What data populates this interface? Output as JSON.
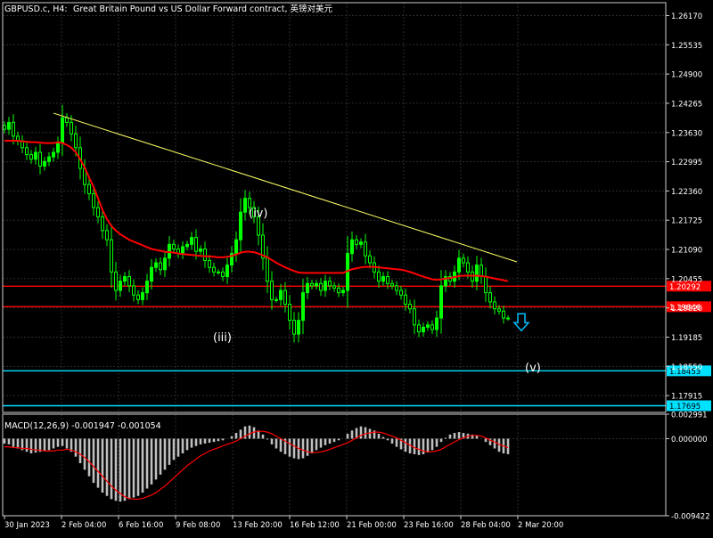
{
  "header": {
    "symbol": "GBPUSD.c, H4:",
    "description": "Great Britain Pound vs US Dollar Forward contract, 英镑对美元"
  },
  "colors": {
    "background": "#000000",
    "grid": "#2d2d2d",
    "frame": "#cfcfcf",
    "candle": "#00ff00",
    "ma": "#ff0000",
    "trendline": "#ffff66",
    "resistance": "#ff0000",
    "support": "#00e0ff",
    "arrow": "#00bfff",
    "text": "#ffffff",
    "macd_hist": "#c0c0c0",
    "macd_signal": "#ff0000"
  },
  "chart_data": [
    {
      "type": "candlestick",
      "ylim": [
        1.1755,
        1.2645
      ],
      "yticks": [
        "1.26170",
        "1.25535",
        "1.24900",
        "1.24265",
        "1.23630",
        "1.22995",
        "1.22360",
        "1.21725",
        "1.21090",
        "1.20455",
        "1.19820",
        "1.19185",
        "1.18550",
        "1.17915"
      ],
      "xticks": [
        "30 Jan 2023",
        "2 Feb 04:00",
        "6 Feb 16:00",
        "9 Feb 08:00",
        "13 Feb 20:00",
        "16 Feb 12:00",
        "21 Feb 00:00",
        "23 Feb 16:00",
        "28 Feb 04:00",
        "2 Mar 20:00"
      ],
      "close": [
        1.237,
        1.2385,
        1.2355,
        1.2345,
        1.233,
        1.2315,
        1.2305,
        1.232,
        1.229,
        1.23,
        1.231,
        1.232,
        1.234,
        1.2395,
        1.2385,
        1.236,
        1.233,
        1.2285,
        1.225,
        1.223,
        1.22,
        1.218,
        1.215,
        1.213,
        1.206,
        1.202,
        1.204,
        1.205,
        1.203,
        1.201,
        1.2,
        1.2015,
        1.204,
        1.207,
        1.208,
        1.2065,
        1.209,
        1.212,
        1.211,
        1.21,
        1.2115,
        1.212,
        1.2135,
        1.2105,
        1.211,
        1.2085,
        1.207,
        1.206,
        1.206,
        1.205,
        1.2075,
        1.21,
        1.213,
        1.219,
        1.222,
        1.22,
        1.218,
        1.214,
        1.209,
        1.204,
        1.2,
        1.2,
        1.202,
        1.199,
        1.1955,
        1.1925,
        1.1955,
        1.2015,
        1.2035,
        1.203,
        1.2035,
        1.202,
        1.204,
        1.203,
        1.2025,
        1.2015,
        1.202,
        1.21,
        1.213,
        1.212,
        1.2125,
        1.2095,
        1.208,
        1.206,
        1.204,
        1.205,
        1.2035,
        1.203,
        1.202,
        1.201,
        1.199,
        1.198,
        1.1945,
        1.193,
        1.194,
        1.1945,
        1.1935,
        1.196,
        1.203,
        1.205,
        1.204,
        1.206,
        1.209,
        1.208,
        1.206,
        1.204,
        1.2075,
        1.205,
        1.2015,
        1.1995,
        1.198,
        1.1975,
        1.196,
        1.196
      ],
      "ma_close": [
        1.2345,
        1.2345,
        1.2345,
        1.2345,
        1.2344,
        1.2343,
        1.2342,
        1.2342,
        1.2341,
        1.234,
        1.234,
        1.234,
        1.2342,
        1.234,
        1.2336,
        1.233,
        1.232,
        1.2305,
        1.2287,
        1.2265,
        1.2245,
        1.222,
        1.2195,
        1.2175,
        1.216,
        1.215,
        1.2142,
        1.2136,
        1.213,
        1.2126,
        1.2122,
        1.2118,
        1.2114,
        1.211,
        1.2108,
        1.2106,
        1.2104,
        1.2103,
        1.2102,
        1.21,
        1.2099,
        1.2098,
        1.2097,
        1.2096,
        1.2095,
        1.2094,
        1.2094,
        1.2093,
        1.2092,
        1.2092,
        1.2093,
        1.2095,
        1.2098,
        1.2102,
        1.2104,
        1.2104,
        1.2103,
        1.21,
        1.2096,
        1.2092,
        1.2086,
        1.208,
        1.2075,
        1.207,
        1.2066,
        1.2062,
        1.2059,
        1.2058,
        1.2058,
        1.2058,
        1.2058,
        1.2058,
        1.2058,
        1.2058,
        1.2058,
        1.2058,
        1.2058,
        1.2062,
        1.2066,
        1.2068,
        1.207,
        1.2071,
        1.2071,
        1.2071,
        1.207,
        1.2069,
        1.2068,
        1.2067,
        1.2066,
        1.2065,
        1.2063,
        1.206,
        1.2057,
        1.2053,
        1.205,
        1.2047,
        1.2044,
        1.2043,
        1.2044,
        1.2046,
        1.2047,
        1.2049,
        1.2051,
        1.2052,
        1.2052,
        1.2052,
        1.2052,
        1.2051,
        1.205,
        1.2048,
        1.2046,
        1.2044,
        1.2042,
        1.204
      ],
      "trendline": [
        [
          1.2405,
          1.2082
        ]
      ],
      "lines": [
        {
          "value": 1.20292,
          "label": "1.20292",
          "color": "#ff0000"
        },
        {
          "value": 1.19846,
          "label": "1.19846",
          "color": "#ff0000"
        },
        {
          "value": 1.18453,
          "label": "1.18453",
          "color": "#00e0ff"
        },
        {
          "value": 1.17695,
          "label": "1.17695",
          "color": "#00e0ff"
        }
      ],
      "annotations": [
        {
          "text": "(iii)",
          "x": 48,
          "y": 1.191
        },
        {
          "text": "(iv)",
          "x": 56,
          "y": 1.218
        },
        {
          "text": "(v)",
          "x": 118,
          "y": 1.1844
        }
      ],
      "arrow": {
        "x": 113,
        "y": 1.195,
        "direction": "down"
      }
    },
    {
      "type": "macd",
      "title": "MACD(12,26,9) -0.001947 -0.001054",
      "ylim": [
        -0.009422,
        0.002991
      ],
      "yticks": [
        "0.002991",
        "0.000000",
        "-0.009422"
      ],
      "hist": [
        -0.0006,
        -0.0007,
        -0.001,
        -0.0012,
        -0.0014,
        -0.0016,
        -0.0018,
        -0.0017,
        -0.0016,
        -0.0015,
        -0.0014,
        -0.0012,
        -0.001,
        -0.0009,
        -0.0012,
        -0.0016,
        -0.0022,
        -0.003,
        -0.0038,
        -0.0046,
        -0.0054,
        -0.006,
        -0.0066,
        -0.007,
        -0.0074,
        -0.0076,
        -0.0077,
        -0.0076,
        -0.0074,
        -0.0072,
        -0.007,
        -0.0066,
        -0.0061,
        -0.0056,
        -0.005,
        -0.0044,
        -0.0038,
        -0.0032,
        -0.0026,
        -0.0022,
        -0.0018,
        -0.0014,
        -0.0011,
        -0.0009,
        -0.0007,
        -0.0006,
        -0.0005,
        -0.0004,
        -0.0003,
        -0.0002,
        0.0,
        0.0003,
        0.0007,
        0.0011,
        0.0015,
        0.0016,
        0.0014,
        0.001,
        0.0005,
        -0.0001,
        -0.0007,
        -0.0012,
        -0.0016,
        -0.0019,
        -0.0022,
        -0.0024,
        -0.0025,
        -0.0024,
        -0.0021,
        -0.0018,
        -0.0014,
        -0.0011,
        -0.0008,
        -0.0006,
        -0.0004,
        -0.0002,
        0.0,
        0.0006,
        0.001,
        0.0013,
        0.0015,
        0.0014,
        0.0012,
        0.001,
        0.0006,
        0.0002,
        -0.0002,
        -0.0006,
        -0.001,
        -0.0013,
        -0.0016,
        -0.0018,
        -0.0019,
        -0.002,
        -0.0019,
        -0.0017,
        -0.0014,
        -0.001,
        -0.0004,
        0.0001,
        0.0005,
        0.0007,
        0.0008,
        0.0007,
        0.0006,
        0.0005,
        0.0004,
        0.0,
        -0.0004,
        -0.0008,
        -0.0012,
        -0.0016,
        -0.0018,
        -0.0019
      ],
      "signal": [
        -0.001,
        -0.001,
        -0.0011,
        -0.0011,
        -0.0012,
        -0.0012,
        -0.0013,
        -0.0014,
        -0.0014,
        -0.0015,
        -0.0015,
        -0.0015,
        -0.0014,
        -0.0014,
        -0.0013,
        -0.0014,
        -0.0016,
        -0.0019,
        -0.0023,
        -0.0028,
        -0.0034,
        -0.004,
        -0.0046,
        -0.0052,
        -0.0058,
        -0.0063,
        -0.0067,
        -0.0071,
        -0.0073,
        -0.0074,
        -0.0074,
        -0.0073,
        -0.0071,
        -0.0069,
        -0.0066,
        -0.0062,
        -0.0058,
        -0.0053,
        -0.0048,
        -0.0043,
        -0.0038,
        -0.0033,
        -0.0029,
        -0.0025,
        -0.0021,
        -0.0018,
        -0.0015,
        -0.0013,
        -0.0011,
        -0.0009,
        -0.0007,
        -0.0005,
        -0.0003,
        0.0,
        0.0003,
        0.0006,
        0.0008,
        0.0009,
        0.0009,
        0.0008,
        0.0006,
        0.0003,
        0.0,
        -0.0003,
        -0.0006,
        -0.0009,
        -0.0012,
        -0.0014,
        -0.0016,
        -0.0017,
        -0.0017,
        -0.0016,
        -0.0015,
        -0.0013,
        -0.0011,
        -0.0009,
        -0.0007,
        -0.0005,
        -0.0002,
        0.0001,
        0.0004,
        0.0006,
        0.0007,
        0.0008,
        0.0008,
        0.0007,
        0.0005,
        0.0003,
        0.0001,
        -0.0002,
        -0.0005,
        -0.0008,
        -0.0011,
        -0.0013,
        -0.0015,
        -0.0016,
        -0.0016,
        -0.0015,
        -0.0013,
        -0.001,
        -0.0007,
        -0.0004,
        -0.0001,
        0.0001,
        0.0003,
        0.0004,
        0.0004,
        0.0003,
        0.0001,
        -0.0002,
        -0.0004,
        -0.0007,
        -0.0009,
        -0.0011
      ]
    }
  ]
}
